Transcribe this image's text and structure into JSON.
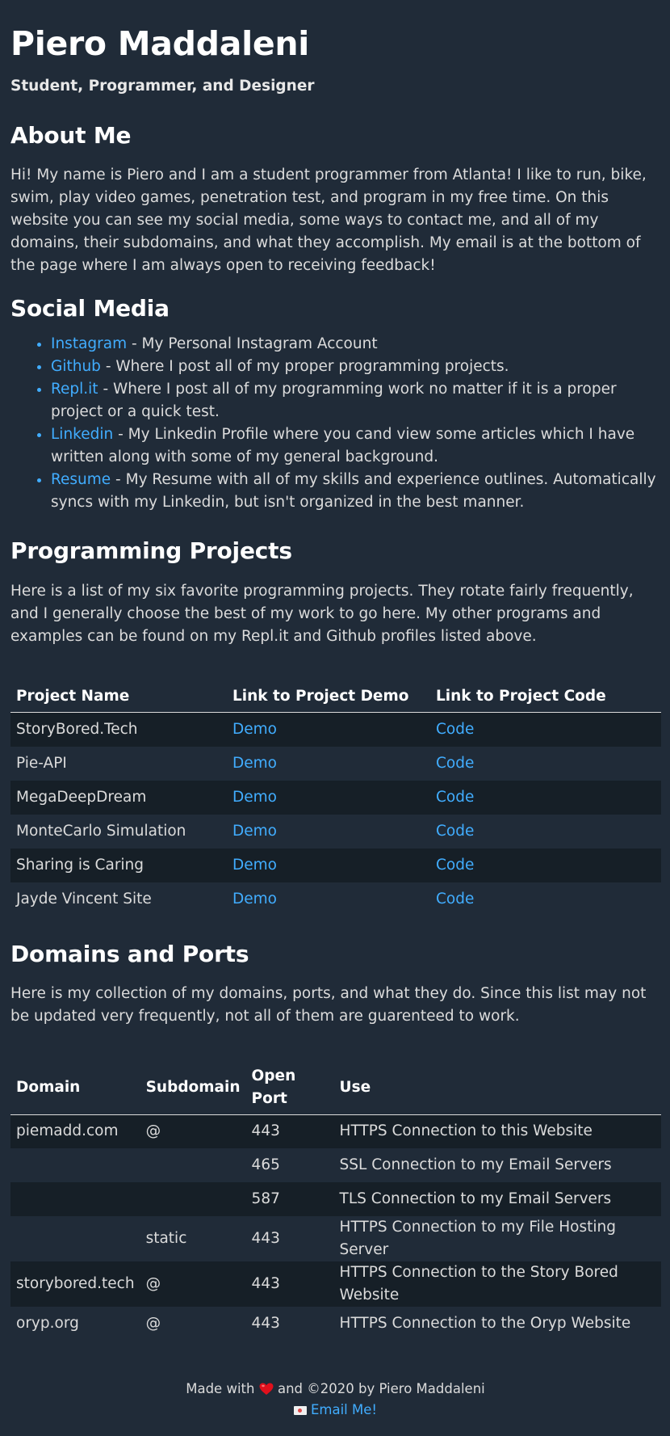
{
  "header": {
    "name": "Piero Maddaleni",
    "tagline": "Student, Programmer, and Designer"
  },
  "about": {
    "heading": "About Me",
    "text": "Hi! My name is Piero and I am a student programmer from Atlanta! I like to run, bike, swim, play video games, penetration test, and program in my free time. On this website you can see my social media, some ways to contact me, and all of my domains, their subdomains, and what they accomplish. My email is at the bottom of the page where I am always open to receiving feedback!"
  },
  "social": {
    "heading": "Social Media",
    "items": [
      {
        "link": "Instagram",
        "desc": " - My Personal Instagram Account"
      },
      {
        "link": "Github",
        "desc": " - Where I post all of my proper programming projects."
      },
      {
        "link": "Repl.it",
        "desc": " - Where I post all of my programming work no matter if it is a proper project or a quick test."
      },
      {
        "link": "Linkedin",
        "desc": " - My Linkedin Profile where you cand view some articles which I have written along with some of my general background."
      },
      {
        "link": "Resume",
        "desc": " - My Resume with all of my skills and experience outlines. Automatically syncs with my Linkedin, but isn't organized in the best manner."
      }
    ]
  },
  "projects": {
    "heading": "Programming Projects",
    "intro": "Here is a list of my six favorite programming projects. They rotate fairly frequently, and I generally choose the best of my work to go here. My other programs and examples can be found on my Repl.it and Github profiles listed above.",
    "columns": [
      "Project Name",
      "Link to Project Demo",
      "Link to Project Code"
    ],
    "rows": [
      {
        "name": "StoryBored.Tech",
        "demo": "Demo",
        "code": "Code"
      },
      {
        "name": "Pie-API",
        "demo": "Demo",
        "code": "Code"
      },
      {
        "name": "MegaDeepDream",
        "demo": "Demo",
        "code": "Code"
      },
      {
        "name": "MonteCarlo Simulation",
        "demo": "Demo",
        "code": "Code"
      },
      {
        "name": "Sharing is Caring",
        "demo": "Demo",
        "code": "Code"
      },
      {
        "name": "Jayde Vincent Site",
        "demo": "Demo",
        "code": "Code"
      }
    ]
  },
  "domains": {
    "heading": "Domains and Ports",
    "intro": "Here is my collection of my domains, ports, and what they do. Since this list may not be updated very frequently, not all of them are guarenteed to work.",
    "columns": [
      "Domain",
      "Subdomain",
      "Open Port",
      "Use"
    ],
    "rows": [
      {
        "domain": "piemadd.com",
        "sub": "@",
        "port": "443",
        "use": "HTTPS Connection to this Website"
      },
      {
        "domain": "",
        "sub": "",
        "port": "465",
        "use": "SSL Connection to my Email Servers"
      },
      {
        "domain": "",
        "sub": "",
        "port": "587",
        "use": "TLS Connection to my Email Servers"
      },
      {
        "domain": "",
        "sub": "static",
        "port": "443",
        "use": "HTTPS Connection to my File Hosting Server"
      },
      {
        "domain": "storybored.tech",
        "sub": "@",
        "port": "443",
        "use": "HTTPS Connection to the Story Bored Website"
      },
      {
        "domain": "oryp.org",
        "sub": "@",
        "port": "443",
        "use": "HTTPS Connection to the Oryp Website"
      }
    ]
  },
  "footer": {
    "made_with": "Made with",
    "credit": " and ©2020 by Piero Maddaleni",
    "email_label": "Email Me!"
  },
  "icons": {
    "heart": "heart-icon",
    "mail": "mail-icon"
  },
  "colors": {
    "background": "#202b38",
    "stripe": "#161f27",
    "link": "#41adff",
    "text": "#dbdbdb",
    "heading": "#ffffff",
    "heart": "#e0101c"
  }
}
